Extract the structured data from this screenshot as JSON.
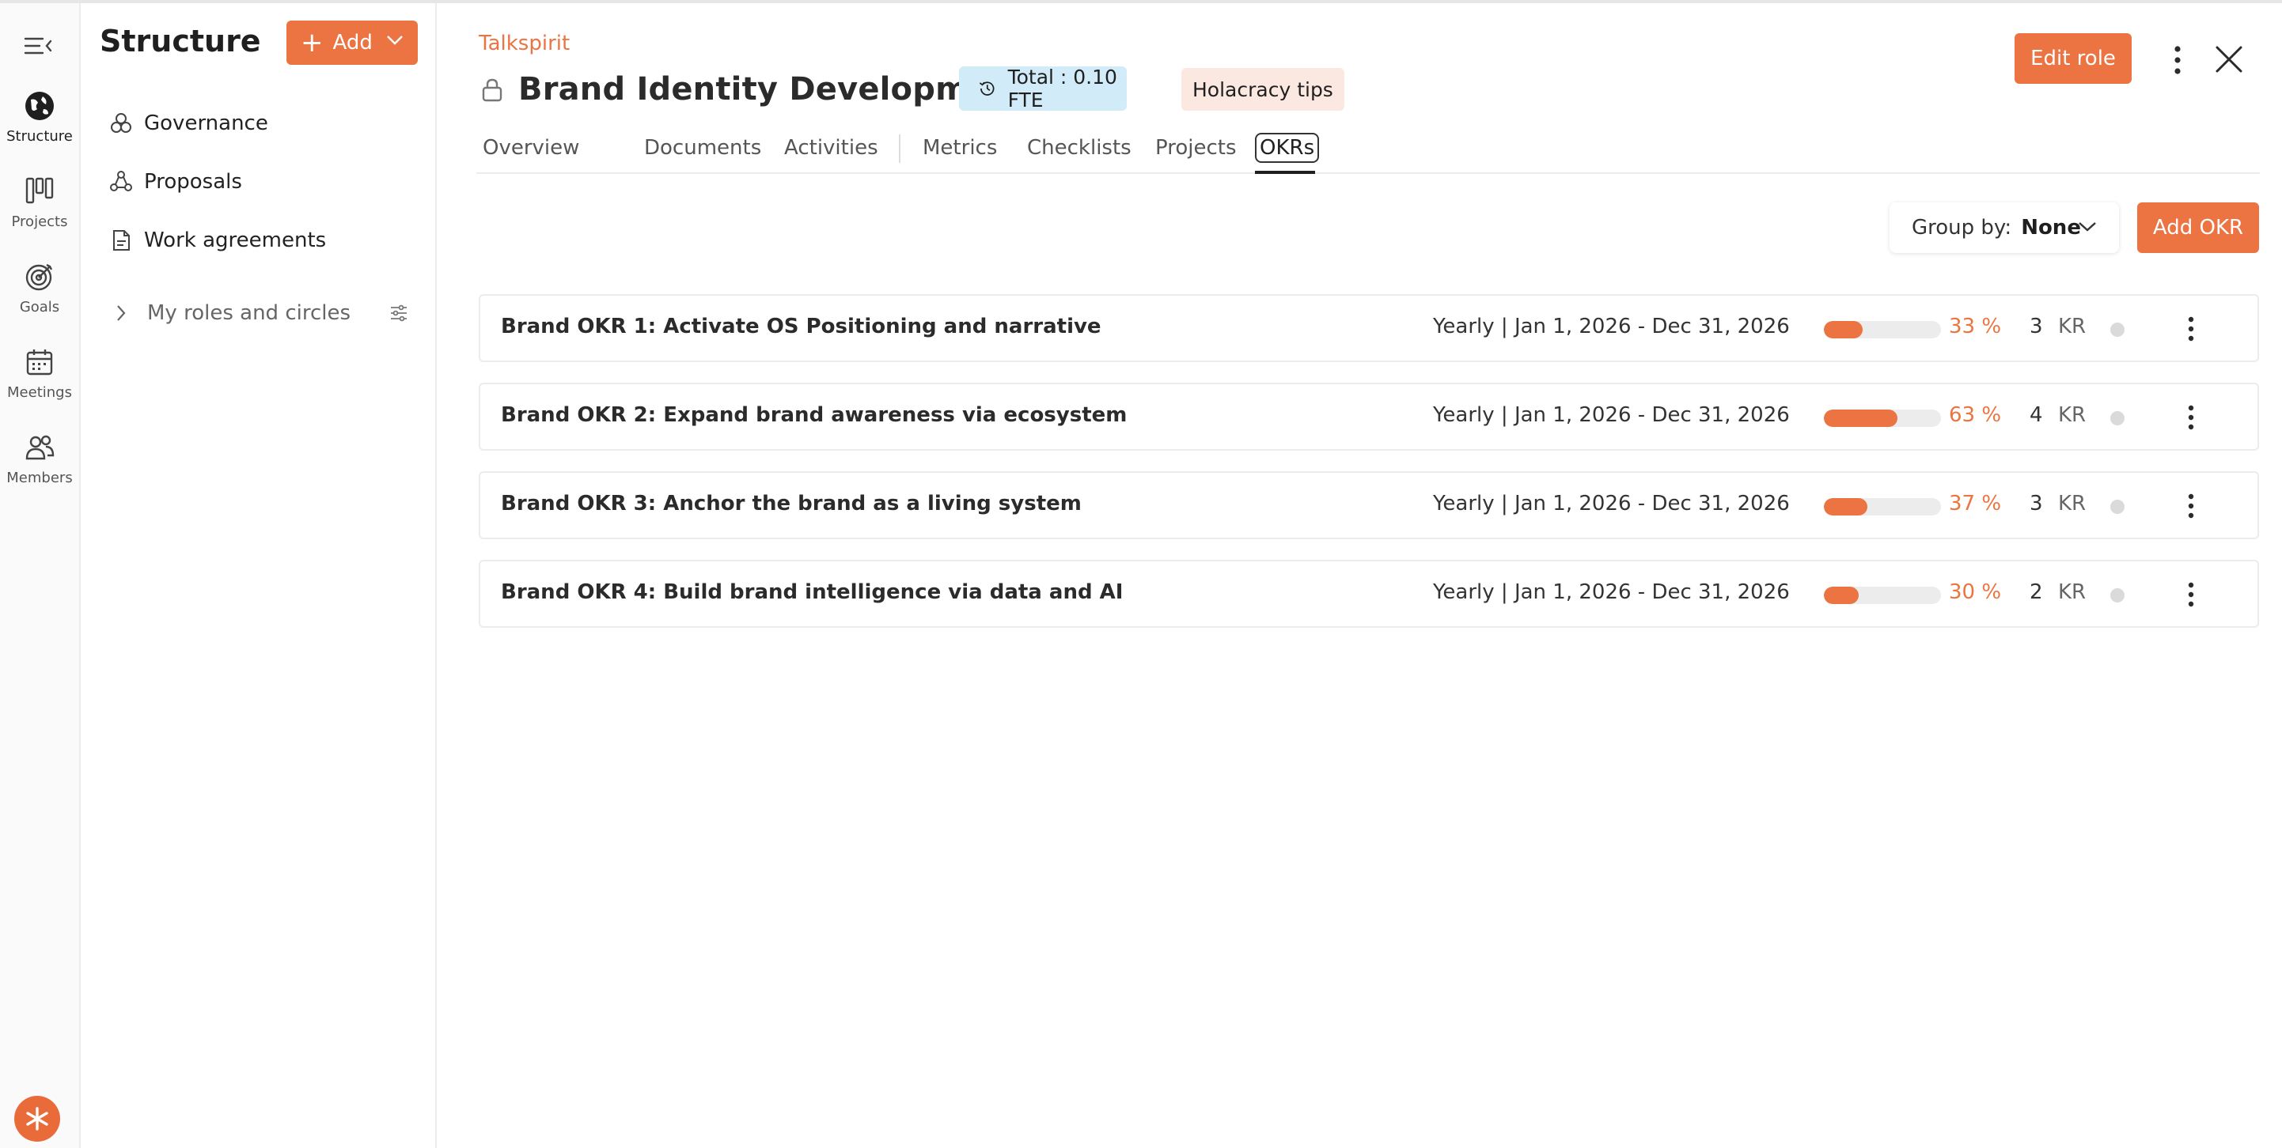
{
  "rail": {
    "items": [
      {
        "label": "Structure",
        "icon": "globe-icon"
      },
      {
        "label": "Projects",
        "icon": "kanban-icon"
      },
      {
        "label": "Goals",
        "icon": "target-icon"
      },
      {
        "label": "Meetings",
        "icon": "calendar-icon"
      },
      {
        "label": "Members",
        "icon": "people-icon"
      }
    ]
  },
  "sidebar": {
    "title": "Structure",
    "add_label": "Add",
    "items": [
      {
        "label": "Governance",
        "icon": "circles-icon"
      },
      {
        "label": "Proposals",
        "icon": "proposals-icon"
      },
      {
        "label": "Work agreements",
        "icon": "document-icon"
      }
    ],
    "roles_label": "My roles and circles"
  },
  "header": {
    "org": "Talkspirit",
    "title": "Brand Identity Development",
    "fte": "Total : 0.10 FTE",
    "tips": "Holacracy tips",
    "edit_label": "Edit role"
  },
  "tabs": [
    {
      "label": "Overview"
    },
    {
      "label": "Documents"
    },
    {
      "label": "Activities"
    },
    {
      "label": "Metrics"
    },
    {
      "label": "Checklists"
    },
    {
      "label": "Projects"
    },
    {
      "label": "OKRs",
      "active": true
    }
  ],
  "toolbar": {
    "group_by_label": "Group by:",
    "group_by_value": "None",
    "add_okr_label": "Add OKR"
  },
  "okrs": [
    {
      "title": "Brand OKR 1: Activate OS Positioning and narrative",
      "period": "Yearly | Jan 1, 2026 - Dec 31, 2026",
      "progress": 0.33,
      "progress_label": "33 %",
      "kr_count": "3",
      "kr_label": "KR"
    },
    {
      "title": "Brand OKR 2: Expand brand awareness via ecosystem",
      "period": "Yearly | Jan 1, 2026 - Dec 31, 2026",
      "progress": 0.63,
      "progress_label": "63 %",
      "kr_count": "4",
      "kr_label": "KR"
    },
    {
      "title": "Brand OKR 3: Anchor the brand as a living system",
      "period": "Yearly | Jan 1, 2026 - Dec 31, 2026",
      "progress": 0.37,
      "progress_label": "37 %",
      "kr_count": "3",
      "kr_label": "KR"
    },
    {
      "title": "Brand OKR 4: Build brand intelligence via data and AI",
      "period": "Yearly | Jan 1, 2026 - Dec 31, 2026",
      "progress": 0.3,
      "progress_label": "30 %",
      "kr_count": "2",
      "kr_label": "KR"
    }
  ],
  "colors": {
    "accent": "#ec7442",
    "fte_badge_bg": "#d2ebf9",
    "tips_badge_bg": "#fbe9e1",
    "progress_track": "#ececec",
    "status_dot": "#dadada"
  }
}
